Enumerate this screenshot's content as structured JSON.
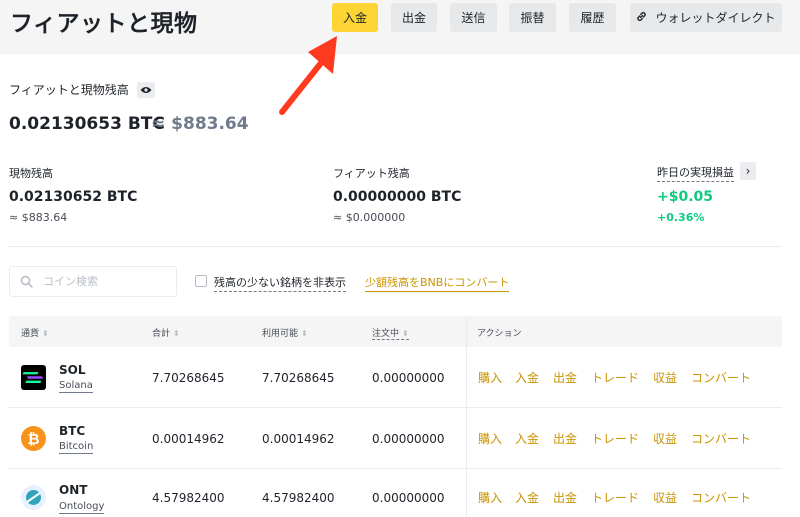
{
  "header": {
    "title": "フィアットと現物",
    "buttons": [
      "入金",
      "出金",
      "送信",
      "振替",
      "履歴"
    ],
    "wallet_direct": "ウォレットダイレクト"
  },
  "balance": {
    "title": "フィアットと現物残高",
    "btc": "0.02130653 BTC",
    "usd": "≈ $883.64"
  },
  "stats": {
    "spot": {
      "label": "現物残高",
      "btc": "0.02130652 BTC",
      "usd": "≈ $883.64"
    },
    "fiat": {
      "label": "フィアット残高",
      "btc": "0.00000000 BTC",
      "usd": "≈ $0.000000"
    },
    "pnl": {
      "label": "昨日の実現損益",
      "value": "+$0.05",
      "percent": "+0.36%"
    }
  },
  "filters": {
    "search_placeholder": "コイン検索",
    "hide_small": "残高の少ない銘柄を非表示",
    "convert_link": "少額残高をBNBにコンバート"
  },
  "table": {
    "headers": {
      "currency": "通貨",
      "total": "合計",
      "available": "利用可能",
      "in_order": "注文中",
      "action": "アクション"
    },
    "rows": [
      {
        "symbol": "SOL",
        "name": "Solana",
        "total": "7.70268645",
        "available": "7.70268645",
        "in_order": "0.00000000"
      },
      {
        "symbol": "BTC",
        "name": "Bitcoin",
        "total": "0.00014962",
        "available": "0.00014962",
        "in_order": "0.00000000"
      },
      {
        "symbol": "ONT",
        "name": "Ontology",
        "total": "4.57982400",
        "available": "4.57982400",
        "in_order": "0.00000000"
      }
    ],
    "actions": [
      "購入",
      "入金",
      "出金",
      "トレード",
      "収益",
      "コンバート"
    ]
  },
  "colors": {
    "accent": "#fcd535",
    "link": "#c99400",
    "positive": "#0ecb81",
    "arrow": "#ff3b1f"
  }
}
